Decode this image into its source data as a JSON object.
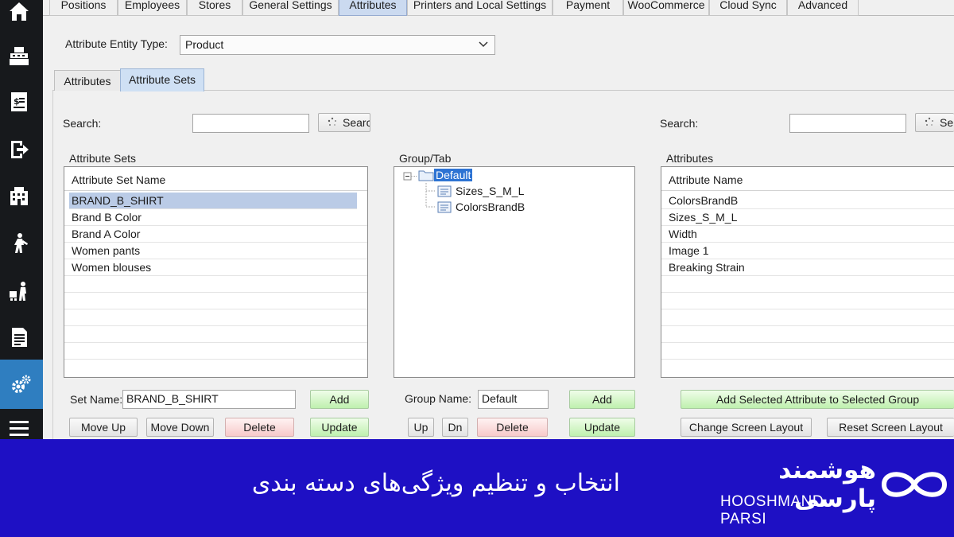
{
  "top_tabs": [
    {
      "label": "Positions"
    },
    {
      "label": "Employees"
    },
    {
      "label": "Stores"
    },
    {
      "label": "General Settings"
    },
    {
      "label": "Attributes",
      "active": true
    },
    {
      "label": "Printers and Local Settings"
    },
    {
      "label": "Payment"
    },
    {
      "label": "WooCommerce"
    },
    {
      "label": "Cloud Sync"
    },
    {
      "label": "Advanced"
    }
  ],
  "sidebar": {
    "items": [
      {
        "icon": "home-icon"
      },
      {
        "icon": "cash-register-icon"
      },
      {
        "icon": "receipt-icon"
      },
      {
        "icon": "exit-icon"
      },
      {
        "icon": "building-icon"
      },
      {
        "icon": "person-walking-icon"
      },
      {
        "icon": "delivery-person-icon"
      },
      {
        "icon": "report-icon"
      },
      {
        "icon": "settings-gears-icon",
        "active": true
      },
      {
        "icon": "menu-icon"
      }
    ]
  },
  "entity": {
    "label": "Attribute Entity Type:",
    "value": "Product"
  },
  "sub_tabs": [
    {
      "label": "Attributes"
    },
    {
      "label": "Attribute Sets",
      "active": true
    }
  ],
  "left": {
    "search_label": "Search:",
    "search_value": "",
    "search_button": "Searc",
    "title": "Attribute Sets",
    "header": "Attribute Set Name",
    "rows": [
      "BRAND_B_SHIRT",
      "Brand B Color",
      "Brand A Color",
      "Women pants",
      "Women blouses"
    ],
    "selected_index": 0,
    "set_name_label": "Set Name:",
    "set_name_value": "BRAND_B_SHIRT",
    "add": "Add",
    "move_up": "Move Up",
    "move_down": "Move Down",
    "delete": "Delete",
    "update": "Update"
  },
  "middle": {
    "title": "Group/Tab",
    "root": "Default",
    "children": [
      "Sizes_S_M_L",
      "ColorsBrandB"
    ],
    "group_name_label": "Group Name:",
    "group_name_value": "Default",
    "add": "Add",
    "up": "Up",
    "dn": "Dn",
    "delete": "Delete",
    "update": "Update"
  },
  "right": {
    "search_label": "Search:",
    "search_value": "",
    "search_button": "Se",
    "title": "Attributes",
    "header": "Attribute Name",
    "rows": [
      "ColorsBrandB",
      "Sizes_S_M_L",
      "Width",
      "Image 1",
      "Breaking Strain"
    ],
    "add_selected": "Add Selected Attribute to Selected Group",
    "change_layout": "Change Screen Layout",
    "reset_layout": "Reset Screen Layout"
  },
  "banner": {
    "title": "انتخاب و تنظیم ویژگی‌های دسته بندی",
    "brand_fa": "هوشمند پارسی",
    "brand_en": "HOOSHMAND PARSI",
    "color": "#1e10c4"
  }
}
